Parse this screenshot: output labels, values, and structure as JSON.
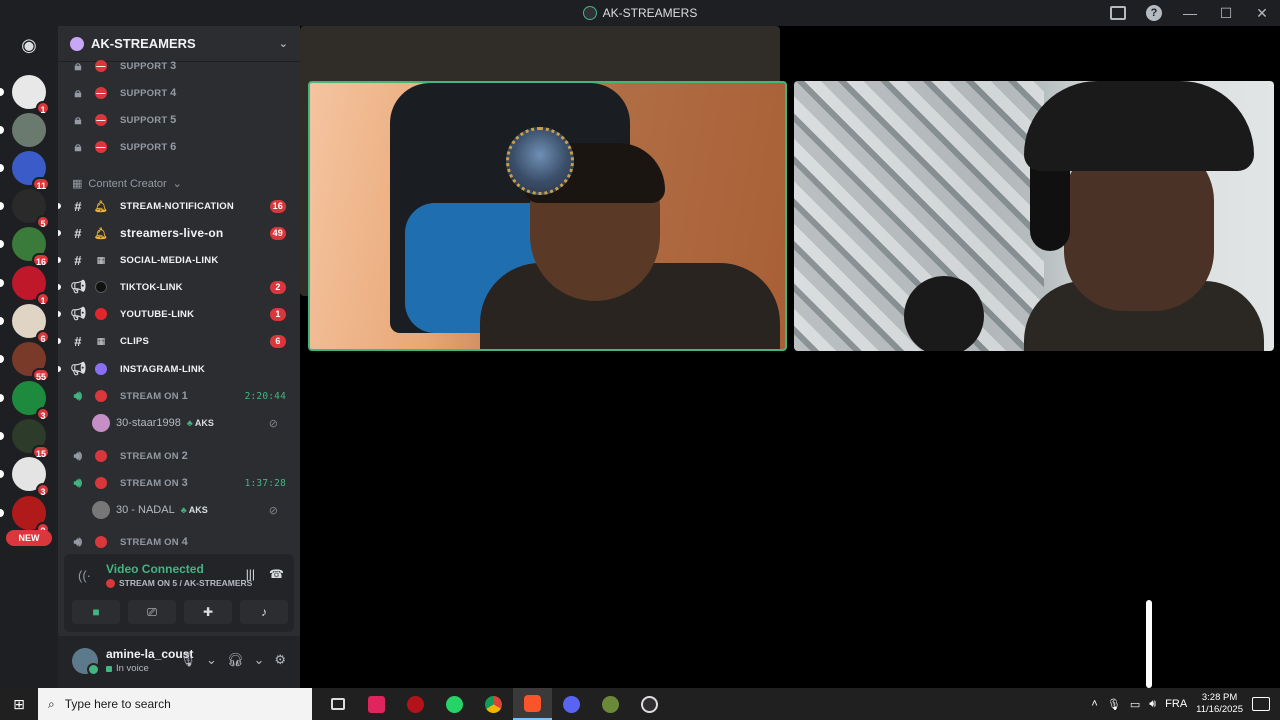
{
  "window": {
    "title": "AK-STREAMERS"
  },
  "server_list": {
    "home_icon": "discord-logo-icon",
    "servers": [
      {
        "badge": "1",
        "color": "#e8e8e8"
      },
      {
        "badge": "",
        "color": "#6b7a6e"
      },
      {
        "badge": "11",
        "color": "#3b5cc8"
      },
      {
        "badge": "5",
        "color": "#2a2a2a"
      },
      {
        "badge": "16",
        "color": "#3a7a3a"
      },
      {
        "badge": "1",
        "color": "#c0182b"
      },
      {
        "badge": "6",
        "color": "#e0d4c4"
      },
      {
        "badge": "55",
        "color": "#7a3a2a"
      },
      {
        "badge": "3",
        "color": "#1e8a3e"
      },
      {
        "badge": "15",
        "color": "#2d3b2a"
      },
      {
        "badge": "3",
        "color": "#e4e4e4"
      },
      {
        "badge": "9",
        "color": "#b01a1a"
      }
    ],
    "new_label": "NEW"
  },
  "sidebar": {
    "guild_name": "AK-STREAMERS",
    "locked_channels": [
      {
        "name": "SUPPORT",
        "num": "3"
      },
      {
        "name": "SUPPORT",
        "num": "4"
      },
      {
        "name": "SUPPORT",
        "num": "5"
      },
      {
        "name": "SUPPORT",
        "num": "6"
      }
    ],
    "category": "Content Creator",
    "channels": [
      {
        "name": "STREAM-NOTIFICATION",
        "icon": "bell-icon",
        "count": "16"
      },
      {
        "name": "streamers-live-on",
        "icon": "bell-icon",
        "count": "49"
      },
      {
        "name": "SOCIAL-MEDIA-LINK",
        "icon": "clapper-icon",
        "count": ""
      },
      {
        "name": "TIKTOK-LINK",
        "icon": "tiktok-icon",
        "count": "2"
      },
      {
        "name": "YOUTUBE-LINK",
        "icon": "youtube-icon",
        "count": "1"
      },
      {
        "name": "CLIPS",
        "icon": "clapper-icon",
        "count": "6"
      },
      {
        "name": "INSTAGRAM-LINK",
        "icon": "instagram-icon",
        "count": ""
      }
    ],
    "voice_channels": [
      {
        "name": "STREAM ON",
        "num": "1",
        "time": "2:20:44"
      },
      {
        "name": "STREAM ON",
        "num": "2",
        "time": ""
      },
      {
        "name": "STREAM ON",
        "num": "3",
        "time": "1:37:28"
      },
      {
        "name": "STREAM ON",
        "num": "4",
        "time": ""
      }
    ],
    "voice_users": [
      {
        "name": "30-staar1998",
        "tag": "AKS"
      },
      {
        "name": "30 - NADAL",
        "tag": "AKS"
      }
    ]
  },
  "voice_panel": {
    "status": "Video Connected",
    "channel": "STREAM ON 5 / AK-STREAMERS"
  },
  "user_panel": {
    "username": "amine-la_coust",
    "status": "In voice"
  },
  "taskbar": {
    "search_placeholder": "Type here to search",
    "language": "FRA",
    "time": "3:28 PM",
    "date": "11/16/2025"
  },
  "colors": {
    "accent_green": "#43b581",
    "notif_red": "#da373c",
    "sidebar_bg": "#2b2d31",
    "server_bg": "#1e1f22"
  }
}
